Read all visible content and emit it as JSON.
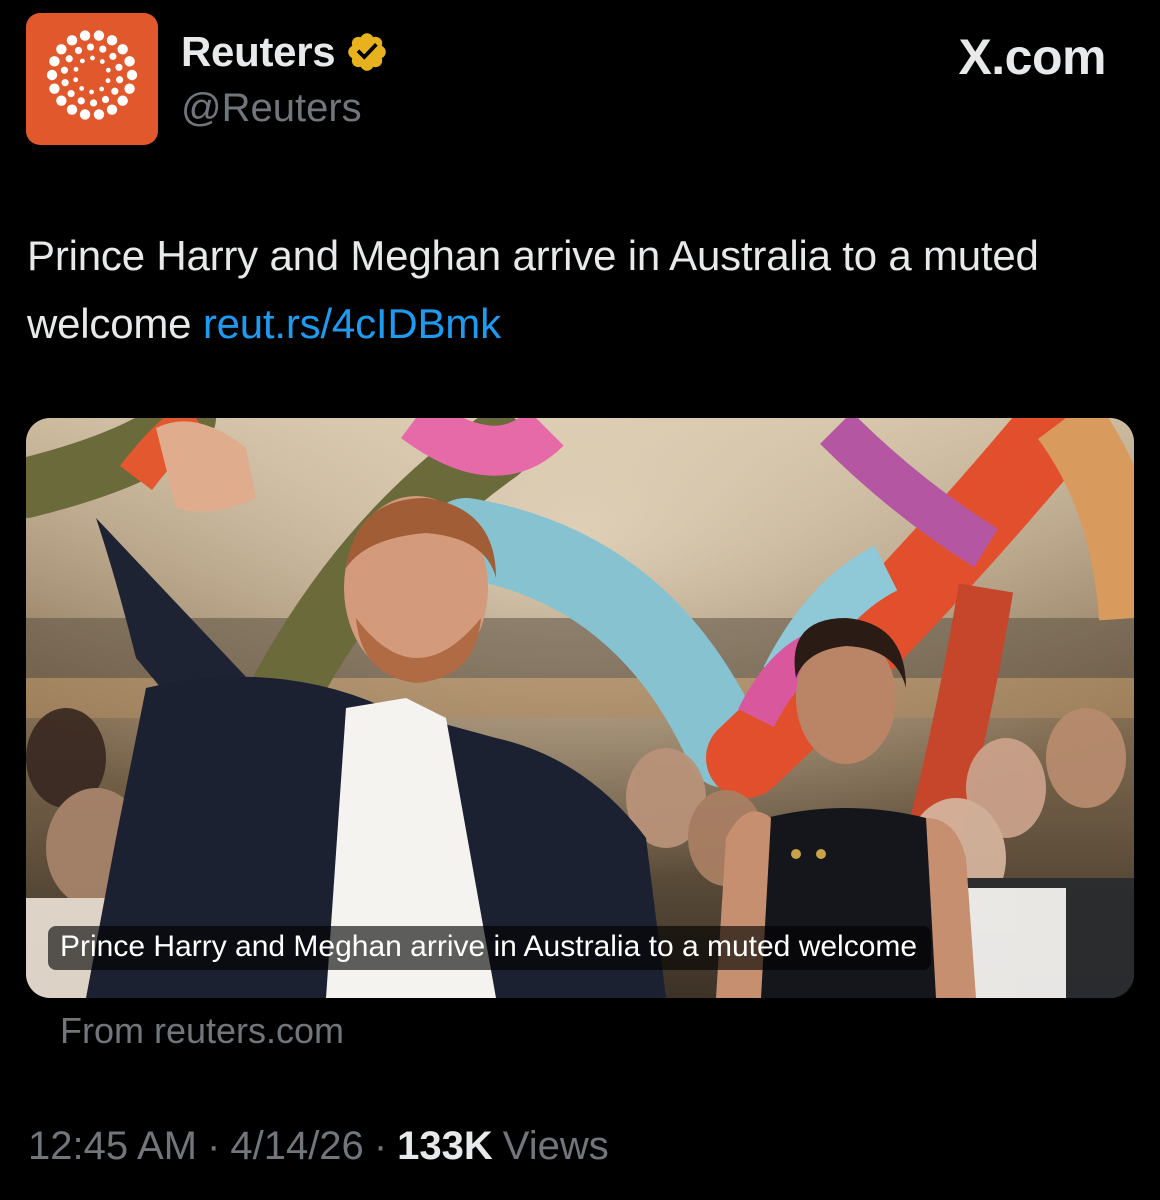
{
  "post": {
    "author": {
      "display_name": "Reuters",
      "handle": "@Reuters",
      "verified": true,
      "avatar_color": "#e1582c",
      "badge_color": "#e8b21f"
    },
    "brand": "X.com",
    "text": "Prince Harry and Meghan arrive in Australia to a muted welcome",
    "link": "reut.rs/4cIDBmk",
    "link_color": "#1d9bf0",
    "card": {
      "caption": "Prince Harry and Meghan arrive in Australia to a muted welcome",
      "source": "From reuters.com",
      "image_icon": "news-photo"
    },
    "meta": {
      "time": "12:45 AM",
      "separator": "·",
      "date": "4/14/26",
      "views_count": "133K",
      "views_label": "Views"
    }
  }
}
